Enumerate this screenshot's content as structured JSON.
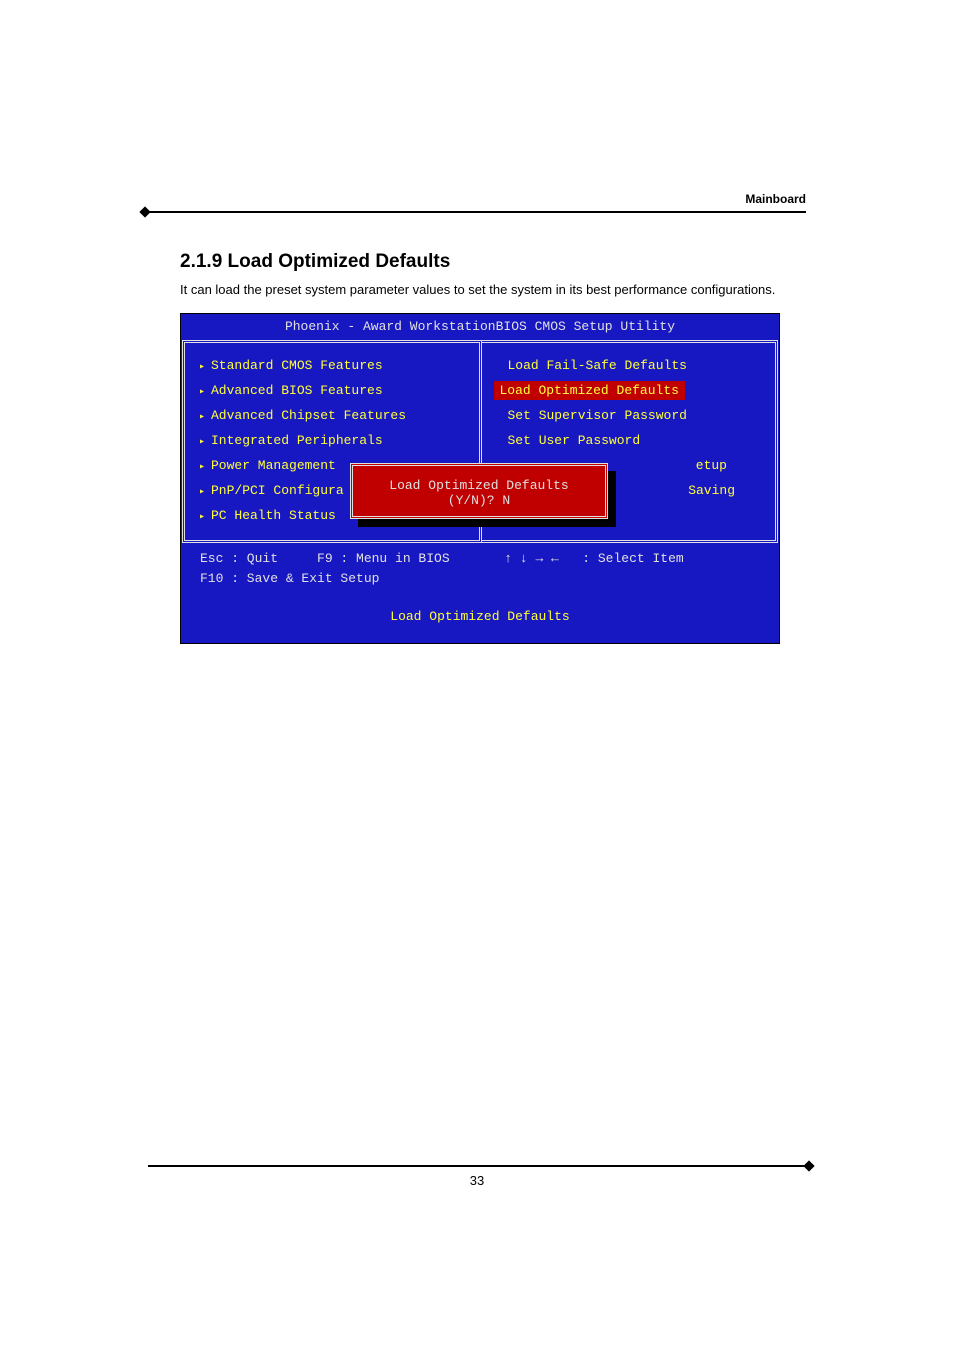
{
  "header": {
    "right_label": "Mainboard"
  },
  "section": {
    "heading": "2.1.9 Load Optimized Defaults",
    "body": "It can load the preset system parameter values to set the system in its best performance configurations."
  },
  "bios": {
    "title": "Phoenix - Award WorkstationBIOS CMOS Setup Utility",
    "left_col": [
      "Standard CMOS Features",
      "Advanced BIOS Features",
      "Advanced Chipset Features",
      "Integrated Peripherals",
      "Power Management",
      "PnP/PCI Configura",
      "PC Health Status"
    ],
    "right_col": [
      {
        "label": "Load Fail-Safe Defaults",
        "selected": false
      },
      {
        "label": "Load Optimized Defaults",
        "selected": true
      },
      {
        "label": "Set Supervisor Password",
        "selected": false
      },
      {
        "label": "Set User Password",
        "selected": false
      },
      {
        "label": "etup",
        "selected": false,
        "suffix": true
      },
      {
        "label": "Saving",
        "selected": false,
        "suffix": true
      }
    ],
    "popup": "Load Optimized Defaults (Y/N)? N",
    "help_line1": "Esc : Quit     F9 : Menu in BIOS       ↑ ↓ → ←   : Select Item",
    "help_line2": "F10 : Save & Exit Setup",
    "footer": "Load Optimized Defaults"
  },
  "page_number": "33"
}
